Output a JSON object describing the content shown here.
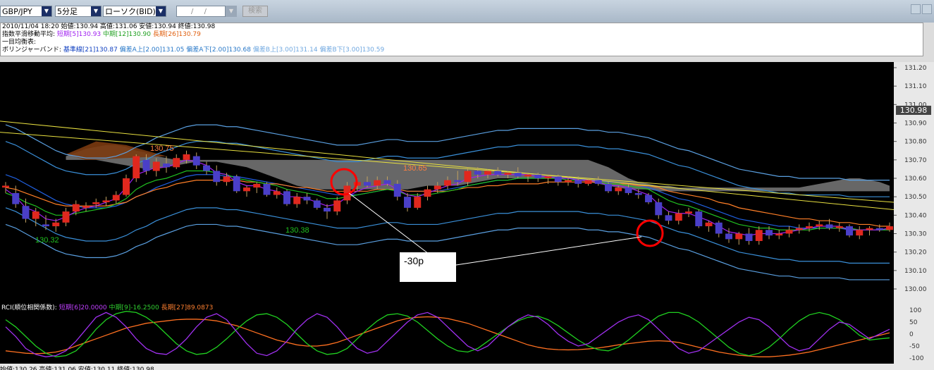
{
  "toolbar": {
    "pair": "GBP/JPY",
    "timeframe": "5分足",
    "chart_type": "ローソク(BID)",
    "date_placeholder": "/ /",
    "search_label": "検索"
  },
  "info": {
    "line1": "2010/11/04 18:20  始値:130.94  高値:131.06  安値:130.94  終値:130.98",
    "ma_label": "指数平滑移動平均:",
    "ma_short": "短期[5]130.93",
    "ma_mid": "中期[12]130.90",
    "ma_long": "長期[26]130.79",
    "ichimoku": "一目均衡表:",
    "bb_label": "ボリンジャーバンド:",
    "bb_base": "基準線[21]130.87",
    "bb_a_up": "偏差A上[2.00]131.05",
    "bb_a_dn": "偏差A下[2.00]130.68",
    "bb_b_up": "偏差B上[3.00]131.14",
    "bb_b_dn": "偏差B下[3.00]130.59"
  },
  "rci": {
    "label": "RCI(順位相関係数):",
    "short": "短期[6]20.0000",
    "mid": "中期[9]-16.2500",
    "long": "長期[27]89.0873"
  },
  "annotation": "-30p",
  "current_price": "130.98",
  "bottom_status": "始値:130.26    高値:131.06    安値:130.11    終値:130.98",
  "colors": {
    "up": "#e0281e",
    "down": "#4a3fc8",
    "ma_short": "#a020f0",
    "ma_mid": "#20c020",
    "ma_long": "#ff7f27",
    "bb_base": "#2060e0",
    "bb_a": "#3a8fd8",
    "bb_b": "#5a9fe0",
    "trend": "#e8e040",
    "cloud": "#8a8a8a"
  },
  "chart_data": {
    "type": "candlestick",
    "ylim": [
      130.0,
      131.2
    ],
    "yticks": [
      "130.00",
      "130.10",
      "130.20",
      "130.30",
      "130.40",
      "130.50",
      "130.60",
      "130.70",
      "130.80",
      "130.90",
      "131.00",
      "131.10",
      "131.20"
    ],
    "annotations": [
      "130.75",
      "130.65",
      "130.38",
      "130.32"
    ],
    "candles": [
      [
        130.55,
        130.58,
        130.52,
        130.56
      ],
      [
        130.52,
        130.56,
        130.44,
        130.46
      ],
      [
        130.45,
        130.49,
        130.36,
        130.38
      ],
      [
        130.38,
        130.44,
        130.34,
        130.42
      ],
      [
        130.35,
        130.4,
        130.32,
        130.34
      ],
      [
        130.34,
        130.38,
        130.31,
        130.36
      ],
      [
        130.36,
        130.44,
        130.34,
        130.42
      ],
      [
        130.42,
        130.48,
        130.4,
        130.46
      ],
      [
        130.44,
        130.47,
        130.42,
        130.45
      ],
      [
        130.46,
        130.49,
        130.44,
        130.47
      ],
      [
        130.47,
        130.5,
        130.45,
        130.48
      ],
      [
        130.48,
        130.53,
        130.46,
        130.51
      ],
      [
        130.51,
        130.62,
        130.5,
        130.6
      ],
      [
        130.6,
        130.73,
        130.58,
        130.72
      ],
      [
        130.7,
        130.73,
        130.62,
        130.64
      ],
      [
        130.64,
        130.71,
        130.61,
        130.69
      ],
      [
        130.68,
        130.72,
        130.63,
        130.66
      ],
      [
        130.66,
        130.73,
        130.65,
        130.71
      ],
      [
        130.7,
        130.75,
        130.68,
        130.73
      ],
      [
        130.72,
        130.74,
        130.65,
        130.67
      ],
      [
        130.67,
        130.69,
        130.62,
        130.64
      ],
      [
        130.64,
        130.67,
        130.56,
        130.58
      ],
      [
        130.58,
        130.63,
        130.56,
        130.61
      ],
      [
        130.61,
        130.62,
        130.52,
        130.53
      ],
      [
        130.53,
        130.56,
        130.5,
        130.55
      ],
      [
        130.55,
        130.58,
        130.52,
        130.57
      ],
      [
        130.57,
        130.58,
        130.5,
        130.51
      ],
      [
        130.51,
        130.55,
        130.49,
        130.53
      ],
      [
        130.53,
        130.54,
        130.45,
        130.46
      ],
      [
        130.46,
        130.52,
        130.44,
        130.5
      ],
      [
        130.5,
        130.52,
        130.46,
        130.48
      ],
      [
        130.48,
        130.49,
        130.43,
        130.44
      ],
      [
        130.44,
        130.46,
        130.38,
        130.42
      ],
      [
        130.42,
        130.5,
        130.4,
        130.48
      ],
      [
        130.48,
        130.58,
        130.46,
        130.56
      ],
      [
        130.56,
        130.6,
        130.53,
        130.58
      ],
      [
        130.58,
        130.61,
        130.55,
        130.56
      ],
      [
        130.56,
        130.61,
        130.54,
        130.59
      ],
      [
        130.59,
        130.61,
        130.56,
        130.57
      ],
      [
        130.57,
        130.59,
        130.48,
        130.5
      ],
      [
        130.5,
        130.52,
        130.42,
        130.44
      ],
      [
        130.44,
        130.52,
        130.43,
        130.5
      ],
      [
        130.5,
        130.56,
        130.48,
        130.54
      ],
      [
        130.54,
        130.58,
        130.52,
        130.56
      ],
      [
        130.56,
        130.61,
        130.54,
        130.59
      ],
      [
        130.59,
        130.64,
        130.56,
        130.58
      ],
      [
        130.58,
        130.66,
        130.56,
        130.64
      ],
      [
        130.64,
        130.66,
        130.6,
        130.62
      ],
      [
        130.62,
        130.65,
        130.6,
        130.64
      ],
      [
        130.64,
        130.66,
        130.61,
        130.62
      ],
      [
        130.62,
        130.64,
        130.6,
        130.63
      ],
      [
        130.63,
        130.66,
        130.6,
        130.61
      ],
      [
        130.61,
        130.63,
        130.58,
        130.62
      ],
      [
        130.62,
        130.63,
        130.58,
        130.6
      ],
      [
        130.6,
        130.62,
        130.57,
        130.61
      ],
      [
        130.61,
        130.62,
        130.56,
        130.58
      ],
      [
        130.58,
        130.61,
        130.56,
        130.59
      ],
      [
        130.59,
        130.61,
        130.55,
        130.57
      ],
      [
        130.57,
        130.6,
        130.56,
        130.59
      ],
      [
        130.59,
        130.61,
        130.56,
        130.57
      ],
      [
        130.57,
        130.58,
        130.52,
        130.53
      ],
      [
        130.53,
        130.56,
        130.51,
        130.55
      ],
      [
        130.55,
        130.57,
        130.51,
        130.52
      ],
      [
        130.52,
        130.54,
        130.49,
        130.51
      ],
      [
        130.51,
        130.52,
        130.46,
        130.47
      ],
      [
        130.47,
        130.49,
        130.38,
        130.4
      ],
      [
        130.4,
        130.42,
        130.35,
        130.37
      ],
      [
        130.37,
        130.43,
        130.35,
        130.41
      ],
      [
        130.41,
        130.44,
        130.39,
        130.42
      ],
      [
        130.42,
        130.43,
        130.33,
        130.34
      ],
      [
        130.34,
        130.37,
        130.31,
        130.36
      ],
      [
        130.36,
        130.37,
        130.28,
        130.3
      ],
      [
        130.3,
        130.33,
        130.25,
        130.27
      ],
      [
        130.27,
        130.31,
        130.24,
        130.3
      ],
      [
        130.3,
        130.33,
        130.24,
        130.26
      ],
      [
        130.26,
        130.34,
        130.24,
        130.32
      ],
      [
        130.32,
        130.34,
        130.27,
        130.29
      ],
      [
        130.29,
        130.32,
        130.27,
        130.3
      ],
      [
        130.3,
        130.34,
        130.28,
        130.32
      ],
      [
        130.32,
        130.35,
        130.3,
        130.33
      ],
      [
        130.33,
        130.36,
        130.31,
        130.34
      ],
      [
        130.34,
        130.37,
        130.32,
        130.35
      ],
      [
        130.35,
        130.38,
        130.32,
        130.33
      ],
      [
        130.33,
        130.36,
        130.31,
        130.34
      ],
      [
        130.34,
        130.35,
        130.28,
        130.29
      ],
      [
        130.29,
        130.34,
        130.27,
        130.32
      ],
      [
        130.32,
        130.34,
        130.29,
        130.33
      ],
      [
        130.33,
        130.35,
        130.31,
        130.32
      ],
      [
        130.32,
        130.36,
        130.31,
        130.34
      ]
    ],
    "ma_short": [
      130.54,
      130.5,
      130.44,
      130.42,
      130.38,
      130.37,
      130.39,
      130.42,
      130.44,
      130.45,
      130.47,
      130.49,
      130.55,
      130.62,
      130.64,
      130.66,
      130.66,
      130.68,
      130.7,
      130.69,
      130.67,
      130.63,
      130.62,
      130.58,
      130.56,
      130.56,
      130.54,
      130.53,
      130.5,
      130.5,
      130.49,
      130.47,
      130.45,
      130.46,
      130.5,
      130.53,
      130.55,
      130.56,
      130.57,
      130.54,
      130.51,
      130.5,
      130.52,
      130.54,
      130.56,
      130.57,
      130.6,
      130.61,
      130.62,
      130.62,
      130.62,
      130.62,
      130.62,
      130.61,
      130.61,
      130.6,
      130.6,
      130.59,
      130.59,
      130.58,
      130.56,
      130.56,
      130.55,
      130.53,
      130.51,
      130.46,
      130.42,
      130.41,
      130.41,
      130.39,
      130.37,
      130.34,
      130.31,
      130.3,
      130.29,
      130.3,
      130.3,
      130.3,
      130.31,
      130.32,
      130.33,
      130.34,
      130.34,
      130.34,
      130.32,
      130.32,
      130.32,
      130.32,
      130.33
    ],
    "ma_mid": [
      130.52,
      130.5,
      130.47,
      130.45,
      130.42,
      130.4,
      130.4,
      130.41,
      130.42,
      130.43,
      130.44,
      130.46,
      130.49,
      130.54,
      130.57,
      130.59,
      130.6,
      130.62,
      130.64,
      130.64,
      130.64,
      130.63,
      130.62,
      130.6,
      130.59,
      130.58,
      130.57,
      130.56,
      130.54,
      130.53,
      130.52,
      130.51,
      130.49,
      130.49,
      130.5,
      130.51,
      130.52,
      130.53,
      130.54,
      130.53,
      130.51,
      130.51,
      130.51,
      130.52,
      130.53,
      130.54,
      130.56,
      130.57,
      130.58,
      130.59,
      130.59,
      130.6,
      130.6,
      130.6,
      130.6,
      130.6,
      130.59,
      130.59,
      130.59,
      130.58,
      130.57,
      130.57,
      130.56,
      130.55,
      130.54,
      130.51,
      130.48,
      130.46,
      130.45,
      130.43,
      130.41,
      130.39,
      130.37,
      130.35,
      130.34,
      130.33,
      130.33,
      130.32,
      130.32,
      130.32,
      130.32,
      130.33,
      130.33,
      130.33,
      130.33,
      130.32,
      130.32,
      130.32,
      130.32
    ],
    "ma_long": [
      130.55,
      130.54,
      130.52,
      130.5,
      130.48,
      130.46,
      130.45,
      130.45,
      130.45,
      130.45,
      130.45,
      130.46,
      130.47,
      130.5,
      130.52,
      130.54,
      130.55,
      130.57,
      130.58,
      130.59,
      130.59,
      130.59,
      130.59,
      130.59,
      130.58,
      130.58,
      130.57,
      130.57,
      130.56,
      130.55,
      130.55,
      130.54,
      130.53,
      130.53,
      130.53,
      130.53,
      130.53,
      130.54,
      130.54,
      130.54,
      130.53,
      130.53,
      130.53,
      130.53,
      130.53,
      130.54,
      130.55,
      130.55,
      130.56,
      130.56,
      130.57,
      130.57,
      130.57,
      130.57,
      130.58,
      130.58,
      130.58,
      130.58,
      130.58,
      130.58,
      130.57,
      130.57,
      130.57,
      130.56,
      130.56,
      130.55,
      130.53,
      130.52,
      130.51,
      130.5,
      130.49,
      130.47,
      130.46,
      130.44,
      130.43,
      130.42,
      130.41,
      130.4,
      130.39,
      130.38,
      130.38,
      130.37,
      130.37,
      130.36,
      130.36,
      130.35,
      130.35,
      130.34,
      130.34
    ],
    "bb_base": [
      130.62,
      130.6,
      130.57,
      130.54,
      130.51,
      130.48,
      130.46,
      130.45,
      130.44,
      130.44,
      130.44,
      130.45,
      130.47,
      130.5,
      130.52,
      130.55,
      130.57,
      130.59,
      130.61,
      130.62,
      130.62,
      130.62,
      130.61,
      130.61,
      130.6,
      130.59,
      130.58,
      130.57,
      130.56,
      130.55,
      130.54,
      130.53,
      130.52,
      130.51,
      130.51,
      130.51,
      130.52,
      130.53,
      130.54,
      130.54,
      130.53,
      130.53,
      130.53,
      130.53,
      130.54,
      130.55,
      130.56,
      130.57,
      130.58,
      130.59,
      130.59,
      130.6,
      130.6,
      130.6,
      130.6,
      130.6,
      130.6,
      130.6,
      130.59,
      130.59,
      130.58,
      130.58,
      130.57,
      130.56,
      130.55,
      130.53,
      130.51,
      130.49,
      130.48,
      130.46,
      130.44,
      130.42,
      130.4,
      130.38,
      130.37,
      130.36,
      130.35,
      130.34,
      130.34,
      130.33,
      130.33,
      130.33,
      130.33,
      130.33,
      130.32,
      130.32,
      130.32,
      130.32,
      130.32
    ],
    "bb_a_width": 0.18,
    "bb_b_width": 0.27,
    "cloud_top": [
      null,
      null,
      null,
      null,
      null,
      null,
      130.72,
      130.74,
      130.76,
      130.77,
      130.78,
      130.78,
      130.77,
      130.75,
      130.74,
      130.72,
      130.71,
      130.7,
      130.7,
      130.7,
      130.7,
      130.7,
      130.7,
      130.7,
      130.7,
      130.7,
      130.7,
      130.7,
      130.7,
      130.7,
      130.7,
      130.7,
      130.7,
      130.7,
      130.7,
      130.7,
      130.7,
      130.7,
      130.7,
      130.7,
      130.7,
      130.7,
      130.7,
      130.7,
      130.7,
      130.7,
      130.7,
      130.7,
      130.7,
      130.7,
      130.7,
      130.7,
      130.7,
      130.7,
      130.7,
      130.7,
      130.7,
      130.7,
      130.7,
      130.68,
      130.66,
      130.63,
      130.6,
      130.58,
      130.57,
      130.56,
      130.56,
      130.55,
      130.55,
      130.55,
      130.55,
      130.55,
      130.55,
      130.55,
      130.55,
      130.55,
      130.55,
      130.55,
      130.55,
      130.55,
      130.56,
      130.57,
      130.58,
      130.59,
      130.6,
      130.6,
      130.59,
      130.58,
      130.56
    ],
    "cloud_bottom": [
      null,
      null,
      null,
      null,
      null,
      null,
      130.7,
      130.7,
      130.7,
      130.7,
      130.69,
      130.68,
      130.67,
      130.66,
      130.65,
      130.65,
      130.66,
      130.67,
      130.68,
      130.69,
      130.69,
      130.69,
      130.68,
      130.67,
      130.66,
      130.64,
      130.62,
      130.6,
      130.58,
      130.56,
      130.55,
      130.54,
      130.54,
      130.54,
      130.54,
      130.54,
      130.54,
      130.54,
      130.54,
      130.54,
      130.54,
      130.55,
      130.56,
      130.56,
      130.56,
      130.56,
      130.57,
      130.58,
      130.59,
      130.6,
      130.6,
      130.6,
      130.6,
      130.6,
      130.6,
      130.6,
      130.6,
      130.59,
      130.58,
      130.57,
      130.56,
      130.55,
      130.54,
      130.54,
      130.54,
      130.53,
      130.53,
      130.53,
      130.53,
      130.53,
      130.53,
      130.53,
      130.53,
      130.53,
      130.53,
      130.53,
      130.53,
      130.53,
      130.53,
      130.53,
      130.53,
      130.53,
      130.53,
      130.53,
      130.53,
      130.53,
      130.53,
      130.53,
      130.53
    ],
    "trendlines": [
      [
        130.91,
        130.43
      ],
      [
        130.85,
        130.47
      ]
    ],
    "rci_yticks": [
      "100",
      "50",
      "0",
      "-50",
      "-100"
    ],
    "rci_short": [
      30,
      -10,
      -60,
      -85,
      -95,
      -90,
      -70,
      -30,
      20,
      70,
      90,
      70,
      30,
      -20,
      -60,
      -80,
      -85,
      -60,
      -20,
      30,
      70,
      85,
      60,
      10,
      -40,
      -80,
      -90,
      -70,
      -30,
      20,
      60,
      85,
      70,
      30,
      -20,
      -60,
      -80,
      -70,
      -30,
      10,
      50,
      80,
      90,
      70,
      30,
      -10,
      -50,
      -70,
      -50,
      -10,
      30,
      60,
      80,
      70,
      40,
      0,
      -30,
      -50,
      -40,
      -10,
      20,
      50,
      70,
      80,
      60,
      20,
      -20,
      -60,
      -80,
      -70,
      -40,
      -10,
      20,
      50,
      70,
      60,
      30,
      -10,
      -50,
      -70,
      -60,
      -20,
      20,
      50,
      40,
      10,
      -20,
      0,
      20
    ],
    "rci_mid": [
      60,
      30,
      -10,
      -50,
      -80,
      -95,
      -90,
      -70,
      -30,
      20,
      60,
      85,
      95,
      90,
      70,
      40,
      0,
      -40,
      -70,
      -85,
      -80,
      -55,
      -20,
      20,
      55,
      80,
      85,
      70,
      40,
      0,
      -40,
      -70,
      -85,
      -80,
      -60,
      -20,
      20,
      55,
      80,
      85,
      75,
      50,
      15,
      -20,
      -50,
      -70,
      -75,
      -60,
      -30,
      0,
      30,
      55,
      70,
      75,
      60,
      35,
      5,
      -25,
      -50,
      -65,
      -70,
      -55,
      -25,
      10,
      45,
      75,
      90,
      90,
      75,
      50,
      15,
      -20,
      -55,
      -80,
      -90,
      -80,
      -55,
      -20,
      20,
      55,
      80,
      90,
      80,
      60,
      30,
      -5,
      -25,
      -20,
      -16
    ],
    "rci_long": [
      -70,
      -75,
      -80,
      -82,
      -80,
      -75,
      -65,
      -50,
      -35,
      -20,
      -5,
      10,
      25,
      35,
      45,
      50,
      55,
      60,
      62,
      62,
      60,
      55,
      45,
      35,
      20,
      5,
      -10,
      -25,
      -35,
      -45,
      -50,
      -50,
      -45,
      -35,
      -20,
      -5,
      10,
      25,
      40,
      55,
      65,
      70,
      72,
      70,
      65,
      55,
      45,
      30,
      15,
      0,
      -15,
      -30,
      -45,
      -55,
      -62,
      -65,
      -66,
      -65,
      -62,
      -58,
      -52,
      -45,
      -40,
      -35,
      -30,
      -28,
      -30,
      -35,
      -45,
      -55,
      -65,
      -75,
      -82,
      -88,
      -92,
      -95,
      -95,
      -92,
      -88,
      -82,
      -75,
      -65,
      -55,
      -45,
      -35,
      -25,
      -15,
      -5,
      5
    ]
  }
}
